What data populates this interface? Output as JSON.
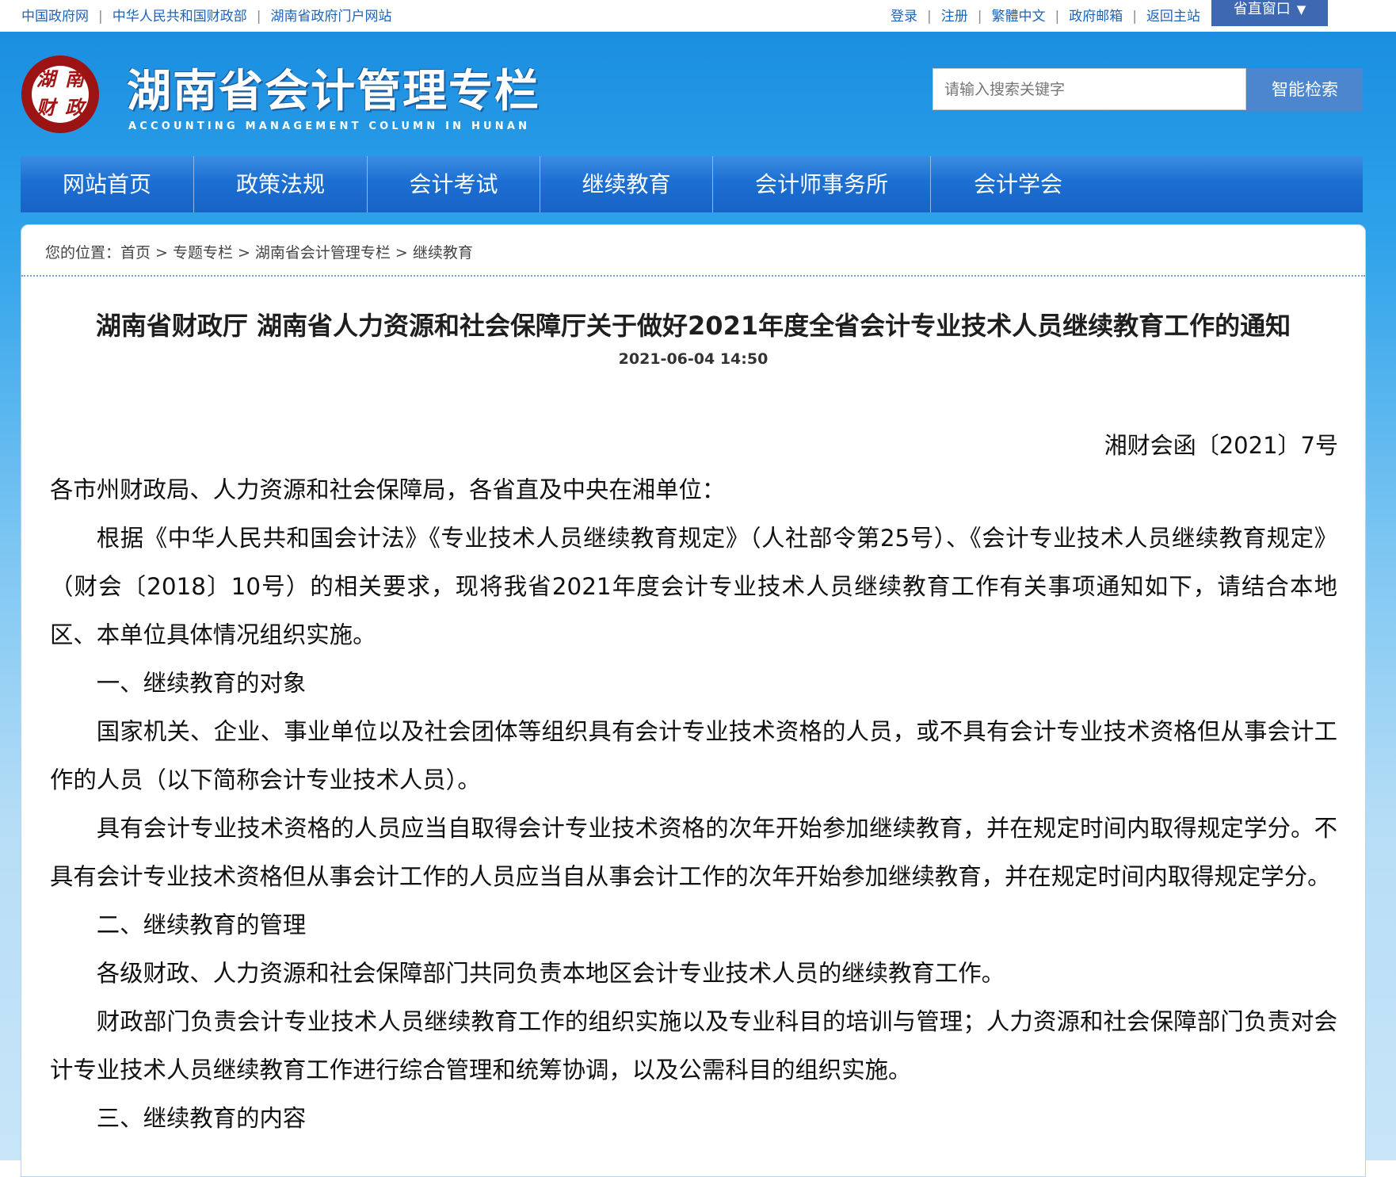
{
  "top_bar": {
    "left_links": [
      "中国政府网",
      "中华人民共和国财政部",
      "湖南省政府门户网站"
    ],
    "right_links": [
      "登录",
      "注册",
      "繁體中文",
      "政府邮箱",
      "返回主站"
    ],
    "province_button": "省直窗口"
  },
  "header": {
    "logo_chars": [
      "湖",
      "南",
      "财",
      "政"
    ],
    "title": "湖南省会计管理专栏",
    "subtitle": "ACCOUNTING MANAGEMENT COLUMN IN HUNAN"
  },
  "search": {
    "placeholder": "请输入搜索关键字",
    "button": "智能检索"
  },
  "nav": {
    "items": [
      "网站首页",
      "政策法规",
      "会计考试",
      "继续教育",
      "会计师事务所",
      "会计学会"
    ]
  },
  "breadcrumb": {
    "prefix": "您的位置：",
    "items": [
      "首页",
      "专题专栏",
      "湖南省会计管理专栏",
      "继续教育"
    ]
  },
  "article": {
    "title": "湖南省财政厅 湖南省人力资源和社会保障厅关于做好2021年度全省会计专业技术人员继续教育工作的通知",
    "date": "2021-06-04 14:50",
    "doc_number": "湘财会函〔2021〕7号",
    "paragraphs": [
      "各市州财政局、人力资源和社会保障局，各省直及中央在湘单位：",
      "根据《中华人民共和国会计法》《专业技术人员继续教育规定》（人社部令第25号）、《会计专业技术人员继续教育规定》（财会〔2018〕10号）的相关要求，现将我省2021年度会计专业技术人员继续教育工作有关事项通知如下，请结合本地区、本单位具体情况组织实施。",
      "一、继续教育的对象",
      "国家机关、企业、事业单位以及社会团体等组织具有会计专业技术资格的人员，或不具有会计专业技术资格但从事会计工作的人员（以下简称会计专业技术人员）。",
      "具有会计专业技术资格的人员应当自取得会计专业技术资格的次年开始参加继续教育，并在规定时间内取得规定学分。不具有会计专业技术资格但从事会计工作的人员应当自从事会计工作的次年开始参加继续教育，并在规定时间内取得规定学分。",
      "二、继续教育的管理",
      "各级财政、人力资源和社会保障部门共同负责本地区会计专业技术人员的继续教育工作。",
      "财政部门负责会计专业技术人员继续教育工作的组织实施以及专业科目的培训与管理；人力资源和社会保障部门负责对会计专业技术人员继续教育工作进行综合管理和统筹协调，以及公需科目的组织实施。",
      "三、继续教育的内容"
    ]
  }
}
